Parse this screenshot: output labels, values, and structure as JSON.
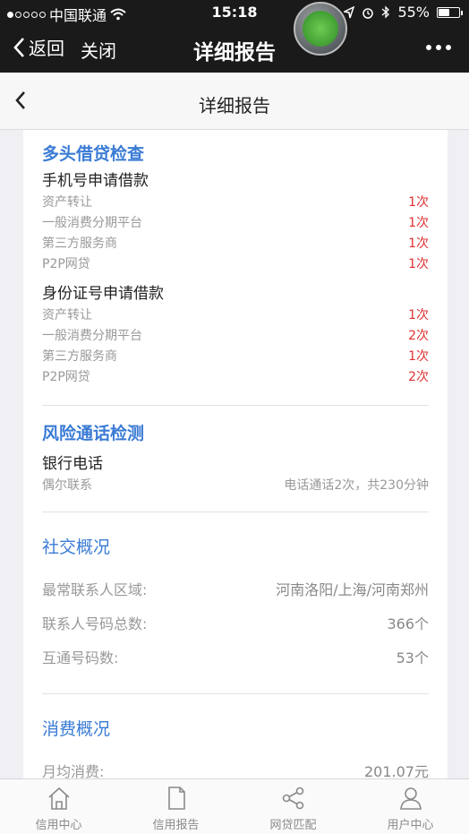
{
  "status_bar": {
    "carrier": "中国联通",
    "time": "15:18",
    "battery": "55%",
    "battery_level": 0.55,
    "signal_bars_filled": 1,
    "signal_bars_total": 5
  },
  "wechat_bar": {
    "back_label": "返回",
    "close_label": "关闭",
    "title": "详细报告"
  },
  "nav": {
    "title": "详细报告"
  },
  "multi_loan": {
    "title": "多头借贷检查",
    "phone": {
      "heading": "手机号申请借款",
      "rows": [
        {
          "label": "资产转让",
          "value": "1次"
        },
        {
          "label": "一般消费分期平台",
          "value": "1次"
        },
        {
          "label": "第三方服务商",
          "value": "1次"
        },
        {
          "label": "P2P网贷",
          "value": "1次"
        }
      ]
    },
    "id_card": {
      "heading": "身份证号申请借款",
      "rows": [
        {
          "label": "资产转让",
          "value": "1次"
        },
        {
          "label": "一般消费分期平台",
          "value": "2次"
        },
        {
          "label": "第三方服务商",
          "value": "1次"
        },
        {
          "label": "P2P网贷",
          "value": "2次"
        }
      ]
    }
  },
  "risk_call": {
    "title": "风险通话检测",
    "heading": "银行电话",
    "row": {
      "label": "偶尔联系",
      "value": "电话通话2次，共230分钟"
    }
  },
  "social": {
    "title": "社交概况",
    "rows": [
      {
        "label": "最常联系人区域:",
        "value": "河南洛阳/上海/河南郑州"
      },
      {
        "label": "联系人号码总数:",
        "value": "366个"
      },
      {
        "label": "互通号码数:",
        "value": "53个"
      }
    ]
  },
  "consumption": {
    "title": "消费概况",
    "rows": [
      {
        "label": "月均消费:",
        "value": "201.07元"
      }
    ]
  },
  "tabbar": [
    {
      "label": "信用中心",
      "icon": "home-icon"
    },
    {
      "label": "信用报告",
      "icon": "document-icon"
    },
    {
      "label": "网贷匹配",
      "icon": "share-icon"
    },
    {
      "label": "用户中心",
      "icon": "user-icon"
    }
  ],
  "colors": {
    "accent": "#3a7bd5",
    "count_red": "#e03030",
    "bar_dark": "#1a1a1a"
  }
}
